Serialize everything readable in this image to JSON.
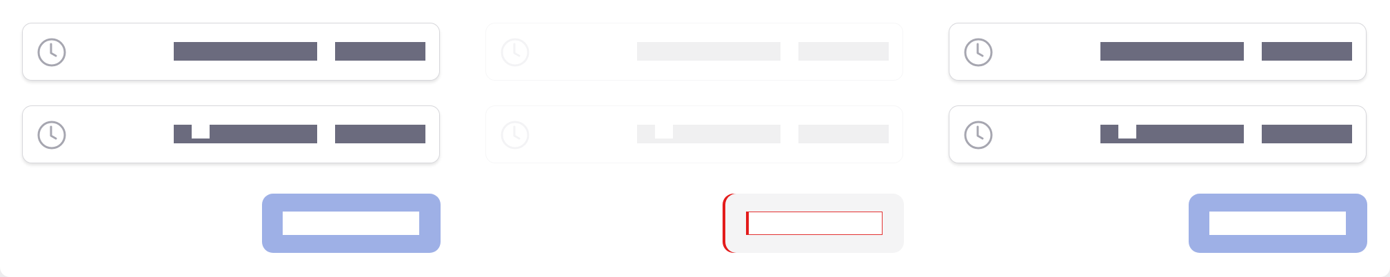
{
  "icons": {
    "row_icon": "clock-icon"
  },
  "colors": {
    "bar": "#6b6b7e",
    "bar_disabled": "#f0f0f1",
    "button": "#9eb0e6",
    "button_disabled": "#f4f4f5",
    "focus_outline": "#e31b1b"
  },
  "panels": [
    {
      "state": "default",
      "rows": 2,
      "button": "enabled"
    },
    {
      "state": "disabled",
      "rows": 2,
      "button": "focused"
    },
    {
      "state": "default",
      "rows": 2,
      "button": "enabled"
    }
  ]
}
